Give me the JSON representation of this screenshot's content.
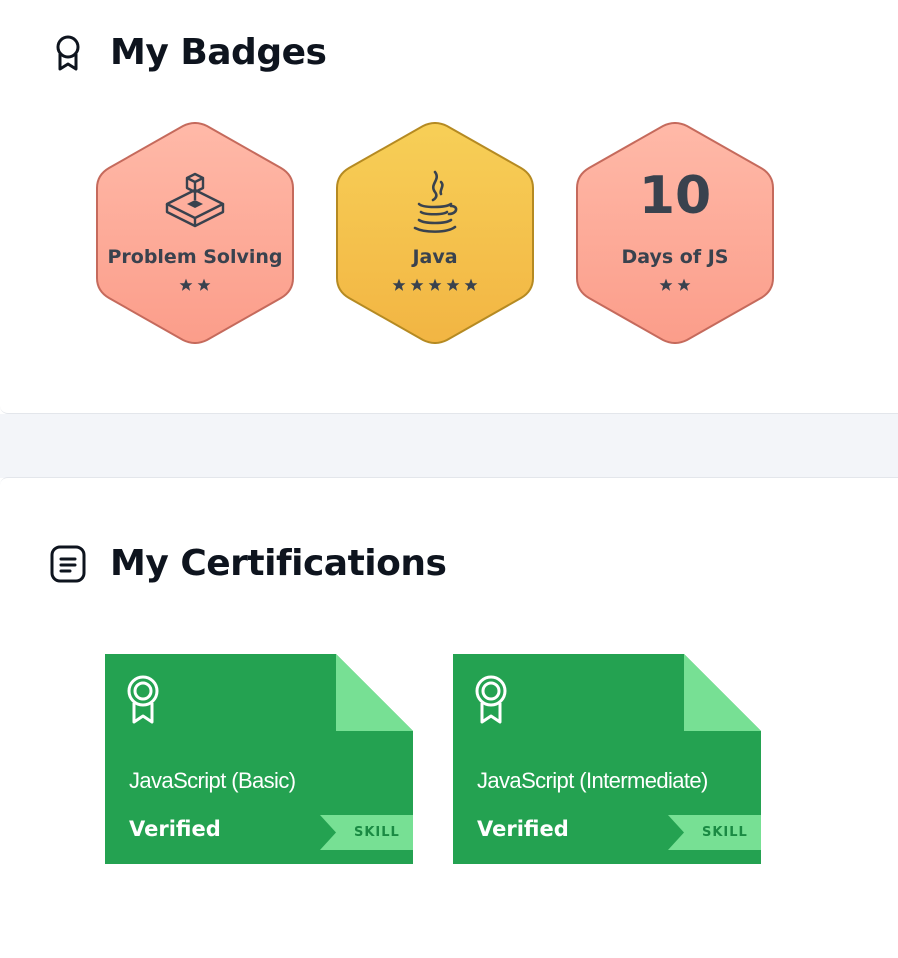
{
  "badges_section": {
    "title": "My Badges",
    "icon": "ribbon-badge-icon",
    "items": [
      {
        "label": "Problem Solving",
        "stars": 2,
        "icon": "problem-solving-icon",
        "color": "#fba193"
      },
      {
        "label": "Java",
        "stars": 5,
        "icon": "java-cup-icon",
        "color": "#f5c24d"
      },
      {
        "label": "Days of JS",
        "stars": 2,
        "number": "10",
        "color": "#fba193"
      }
    ]
  },
  "certifications_section": {
    "title": "My Certifications",
    "icon": "document-list-icon",
    "items": [
      {
        "name": "JavaScript (Basic)",
        "status": "Verified",
        "tag": "SKILL"
      },
      {
        "name": "JavaScript (Intermediate)",
        "status": "Verified",
        "tag": "SKILL"
      }
    ]
  },
  "colors": {
    "cert_green": "#24a251",
    "cert_green_light": "#77e094",
    "badge_salmon": "#fba193",
    "badge_gold": "#f5c24d",
    "page_bg_band": "#f3f5f9"
  }
}
